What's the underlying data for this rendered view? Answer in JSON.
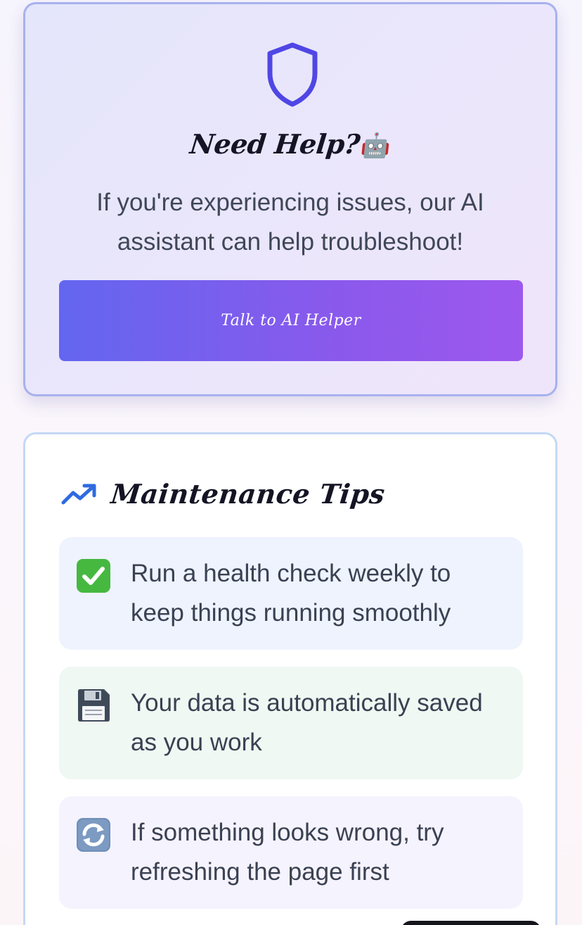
{
  "help_card": {
    "icon": "shield-icon",
    "title": "Need Help?",
    "title_emoji": "🤖",
    "description": "If you're experiencing issues, our AI assistant can help troubleshoot!",
    "button_label": "Talk to AI Helper"
  },
  "tips_card": {
    "icon": "trend-up-icon",
    "title": "Maintenance Tips",
    "items": [
      {
        "icon": "check-mark-icon",
        "text": "Run a health check weekly to keep things running smoothly"
      },
      {
        "icon": "floppy-disk-icon",
        "text": "Your data is automatically saved as you work"
      },
      {
        "icon": "refresh-icon",
        "text": "If something looks wrong, try refreshing the page first"
      }
    ]
  },
  "colors": {
    "accent_indigo": "#4f46e5",
    "button_gradient_start": "#6366f0",
    "button_gradient_end": "#9d58ee",
    "trend_icon": "#2f6be0",
    "help_border": "#a7b1ee",
    "tips_border": "#c4d8f6"
  }
}
